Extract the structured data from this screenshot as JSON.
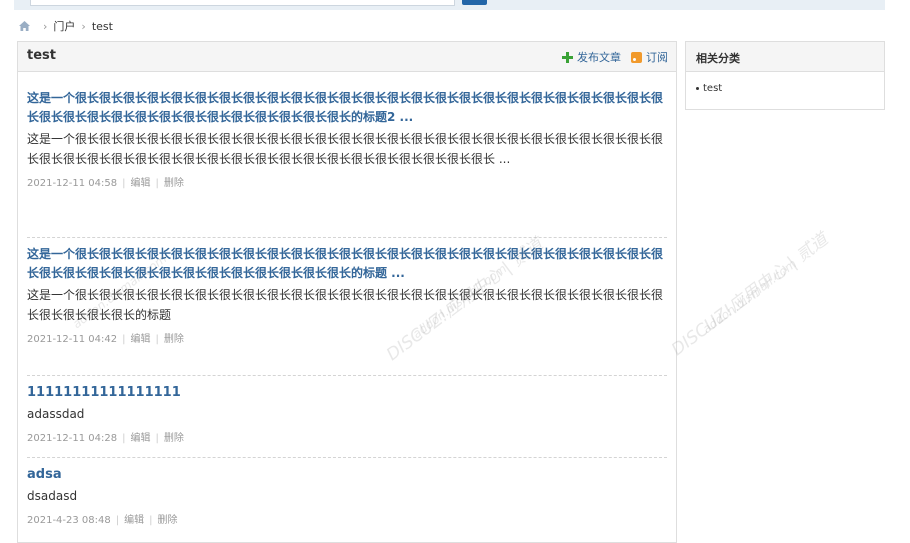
{
  "breadcrumb": {
    "items": [
      "门户",
      "test"
    ]
  },
  "main": {
    "title": "test",
    "publish_label": "发布文章",
    "subscribe_label": "订阅"
  },
  "articles": [
    {
      "title": "这是一个很长很长很长很长很长很长很长很长很长很长很长很长很长很长很长很长很长很长很长很长很长很长很长很长很长很长很长很长很长很长很长很长很长很长很长很长很长很长的标题2 ...",
      "summary": "这是一个很长很长很长很长很长很长很长很长很长很长很长很长很长很长很长很长很长很长很长很长很长很长很长很长很长很长很长很长很长很长很长很长很长很长很长很长很长很长很长很长很长很长很长很长 ...",
      "date": "2021-12-11 04:58",
      "edit": "编辑",
      "delete": "删除"
    },
    {
      "title": "这是一个很长很长很长很长很长很长很长很长很长很长很长很长很长很长很长很长很长很长很长很长很长很长很长很长很长很长很长很长很长很长很长很长很长很长很长很长很长很长的标题 ...",
      "summary": "这是一个很长很长很长很长很长很长很长很长很长很长很长很长很长很长很长很长很长很长很长很长很长很长很长很长很长很长很长很长很长的标题",
      "date": "2021-12-11 04:42",
      "edit": "编辑",
      "delete": "删除"
    },
    {
      "title": "11111111111111111",
      "summary": "adassdad",
      "date": "2021-12-11 04:28",
      "edit": "编辑",
      "delete": "删除"
    },
    {
      "title": "adsa",
      "summary": "dsadasd",
      "date": "2021-4-23 08:48",
      "edit": "编辑",
      "delete": "删除"
    }
  ],
  "sidebar": {
    "title": "相关分类",
    "items": [
      "test"
    ]
  },
  "watermarks": [
    "DISCUZ!应用中心 | 贰道",
    "addon.dismall.com"
  ]
}
